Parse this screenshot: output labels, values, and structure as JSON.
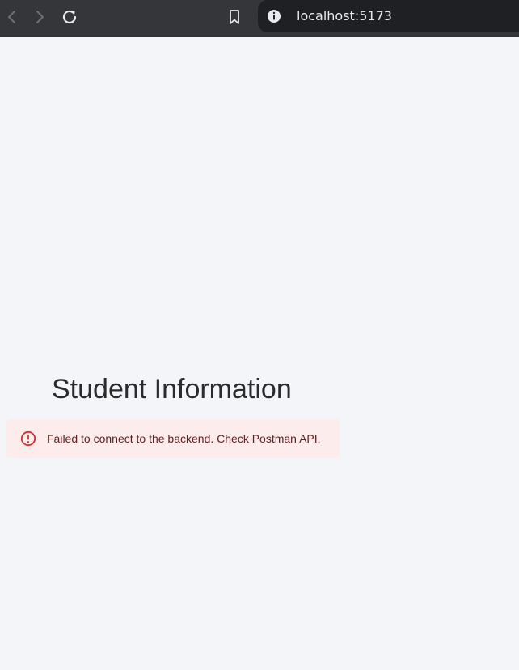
{
  "browser": {
    "url": "localhost:5173",
    "icons": {
      "back": "chevron-left-icon",
      "forward": "chevron-right-icon",
      "reload": "reload-icon",
      "bookmark": "bookmark-icon",
      "site_info": "info-icon"
    }
  },
  "page": {
    "title": "Student Information",
    "alert": {
      "severity": "error",
      "icon": "error-outline-icon",
      "message": "Failed to connect to the backend. Check Postman API.",
      "colors": {
        "background": "#fdecec",
        "text": "#5f2120",
        "icon": "#d32f2f"
      }
    }
  }
}
